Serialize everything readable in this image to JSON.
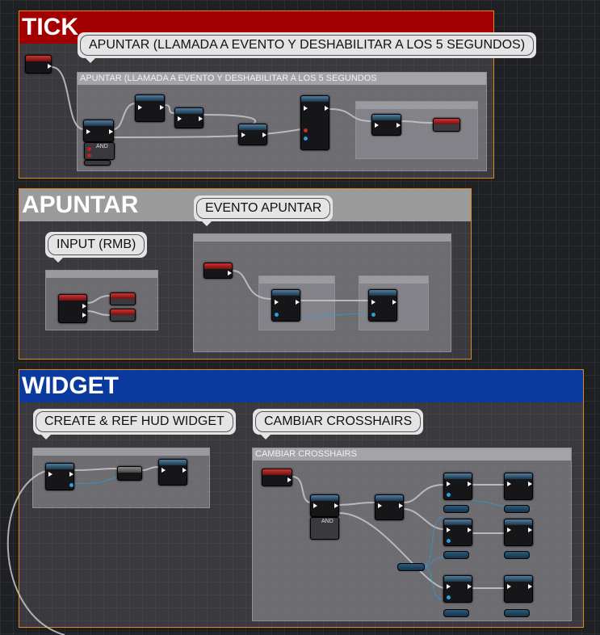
{
  "colors": {
    "tick": "#a20000",
    "apuntar": "#9b9b9b",
    "widget": "#0b3a9e",
    "frame": "#e08a1e"
  },
  "sections": {
    "tick": {
      "title": "TICK"
    },
    "apuntar": {
      "title": "APUNTAR"
    },
    "widget": {
      "title": "WIDGET"
    }
  },
  "bubbles": {
    "tick_apuntar": "APUNTAR (LLAMADA A EVENTO Y DESHABILITAR A LOS 5 SEGUNDOS)",
    "input": "INPUT (RMB)",
    "evento_apuntar": "EVENTO APUNTAR",
    "create_hud": "CREATE & REF HUD WIDGET",
    "cambiar": "CAMBIAR CROSSHAIRS"
  },
  "comments": {
    "tick_apuntar": "APUNTAR (LLAMADA A EVENTO Y DESHABILITAR A LOS 5 SEGUNDOS",
    "cambiar": "CAMBIAR CROSSHAIRS"
  },
  "nodes": {
    "and_label": "AND"
  }
}
